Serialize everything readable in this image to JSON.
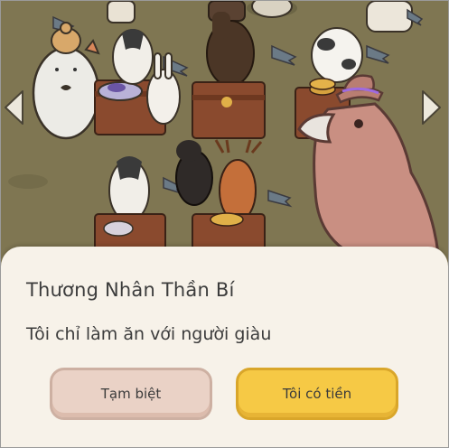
{
  "dialog": {
    "title": "Thương Nhân Thần Bí",
    "message": "Tôi chỉ làm ăn với người giàu",
    "buttons": {
      "goodbye": "Tạm biệt",
      "rich": "Tôi có tiền"
    }
  },
  "icons": {
    "nav_left": "chevron-left-icon",
    "nav_right": "chevron-right-icon"
  },
  "colors": {
    "dialog_bg": "#f7f2e9",
    "goodbye_button": "#ead2c6",
    "rich_button": "#f6c945",
    "merchant_body": "#c98f82"
  }
}
